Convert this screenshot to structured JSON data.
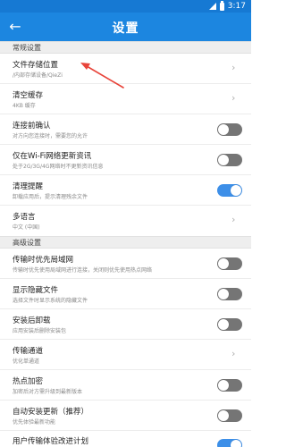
{
  "status": {
    "time": "3:17"
  },
  "header": {
    "title": "设置",
    "back_icon": "back-arrow-icon"
  },
  "sections": {
    "general": "常规设置",
    "advanced": "高级设置"
  },
  "rows": [
    {
      "title": "文件存储位置",
      "subtitle": "/内部存储设备/QieZi",
      "control": "chevron"
    },
    {
      "title": "清空缓存",
      "subtitle": "4KB 缓存",
      "control": "chevron"
    },
    {
      "title": "连接前确认",
      "subtitle": "对方向您连接时，需要您的允许",
      "control": "toggle",
      "on": false
    },
    {
      "title": "仅在Wi-Fi网络更新资讯",
      "subtitle": "处于2G/3G/4G网络时不更新资讯信息",
      "control": "toggle",
      "on": false
    },
    {
      "title": "清理提醒",
      "subtitle": "卸载应用后，提示清理残余文件",
      "control": "toggle",
      "on": true
    },
    {
      "title": "多语言",
      "subtitle": "中文 (中国)",
      "control": "chevron"
    },
    {
      "title": "传输时优先局域网",
      "subtitle": "传输时优先使用局域网进行连接，关闭则优先使用热点网络",
      "control": "toggle",
      "on": false
    },
    {
      "title": "显示隐藏文件",
      "subtitle": "选择文件时显示系统的隐藏文件",
      "control": "toggle",
      "on": false
    },
    {
      "title": "安装后卸载",
      "subtitle": "应用安装后删除安装包",
      "control": "toggle",
      "on": false
    },
    {
      "title": "传输通道",
      "subtitle": "优化单通道",
      "control": "chevron"
    },
    {
      "title": "热点加密",
      "subtitle": "加密后对方需升级到最新版本",
      "control": "toggle",
      "on": false
    },
    {
      "title": "自动安装更新（推荐）",
      "subtitle": "优先体验最新功能",
      "control": "toggle",
      "on": false
    },
    {
      "title": "用户传输体验改进计划",
      "subtitle": "",
      "control": "toggle",
      "on": true
    }
  ],
  "colors": {
    "toolbar": "#1c86e0",
    "status_bar": "#1679d3",
    "toggle_on": "#3d8fe8",
    "toggle_off": "#757575",
    "annotation_arrow": "#e8443a"
  }
}
